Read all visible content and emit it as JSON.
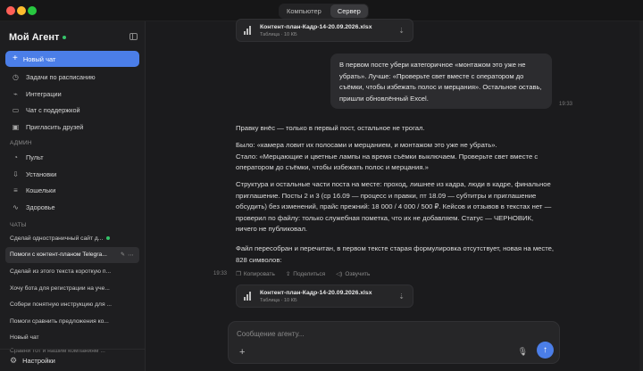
{
  "titlebar": {
    "tabs": [
      {
        "label": "Компьютер",
        "active": false
      },
      {
        "label": "Сервер",
        "active": true
      }
    ]
  },
  "sidebar": {
    "brand": "Мой Агент",
    "new_chat": "Новый чат",
    "items": [
      {
        "label": "Задачи по расписанию",
        "icon": "clock-icon"
      },
      {
        "label": "Интеграции",
        "icon": "plug-icon"
      },
      {
        "label": "Чат с поддержкой",
        "icon": "chat-icon"
      },
      {
        "label": "Пригласить друзей",
        "icon": "gift-icon"
      }
    ],
    "admin_label": "АДМИН",
    "admin_items": [
      {
        "label": "Пульт",
        "icon": "dashboard-icon"
      },
      {
        "label": "Установки",
        "icon": "download-icon"
      },
      {
        "label": "Кошельки",
        "icon": "wallet-icon"
      },
      {
        "label": "Здоровье",
        "icon": "pulse-icon"
      }
    ],
    "chats_label": "ЧАТЫ",
    "chats": [
      "Сделай одностраничный сайт д...",
      "Помоги с контент-планом Telegra...",
      "Сделай из этого текста короткую п...",
      "Хочу бота для регистрации на уче...",
      "Собери понятную инструкцию для ...",
      "Помоги сравнить предложения ко...",
      "Новый чат",
      "Сравни тот и нашим компаниям ..."
    ],
    "settings": "Настройки"
  },
  "file": {
    "name": "Контент-план-Кадр-14-20.09.2026.xlsx",
    "meta": "Таблица · 10 КБ"
  },
  "messages": {
    "user": "В первом посте убери категоричное «монтажом это уже не убрать». Лучше: «Проверьте свет вместе с оператором до съёмки, чтобы избежать полос и мерцания». Остальное оставь, пришли обновлённый Excel.",
    "user_time": "19:33",
    "assistant_p1": "Правку внёс — только в первый пост, остальное не трогал.",
    "assistant_p2_a": "Было: «камера ловит их полосами и мерцанием, и монтажом это уже не убрать».",
    "assistant_p2_b": "Стало: «Мерцающие и цветные лампы на время съёмки выключаем. Проверьте свет вместе с оператором до съёмки, чтобы избежать полос и мерцания.»",
    "assistant_p3": "Структура и остальные части поста на месте: проход, лишнее из кадра, люди в кадре, финальное приглашение. Посты 2 и 3 (ср 16.09 — процесс и правки, пт 18.09 — субтитры и приглашение обсудить) без изменений, прайс прежний: 18 000 / 4 000 / 500 ₽. Кейсов и отзывов в текстах нет — проверил по файлу: только служебная пометка, что их не добавляем. Статус — ЧЕРНОВИК, ничего не публиковал.",
    "assistant_p4": "Файл пересобран и перечитан, в первом тексте старая формулировка отсутствует, новая на месте, 828 символов:",
    "assistant_time": "19:33"
  },
  "actions": {
    "copy": "Копировать",
    "share": "Поделиться",
    "speak": "Озвучить"
  },
  "composer": {
    "placeholder": "Сообщение агенту..."
  }
}
